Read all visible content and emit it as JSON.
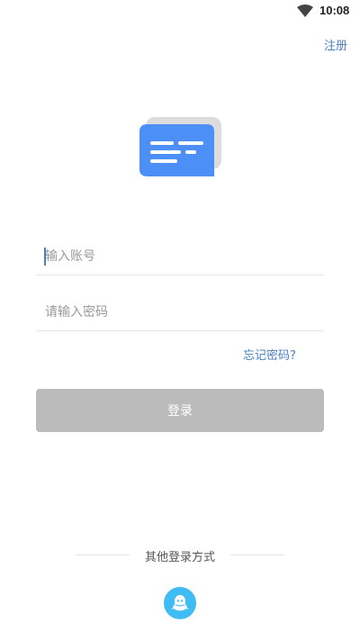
{
  "status_bar": {
    "time": "10:08",
    "wifi_icon": "wifi-icon"
  },
  "header": {
    "register_label": "注册"
  },
  "logo": {
    "icon": "chat-card-logo-icon",
    "front_color": "#4b8ff7",
    "back_color": "#dcdcdc"
  },
  "form": {
    "account_placeholder": "输入账号",
    "password_placeholder": "请输入密码",
    "forgot_label": "忘记密码?",
    "login_label": "登录",
    "login_color": "#bbbbbb",
    "link_color": "#4a7fc1"
  },
  "other_login": {
    "title": "其他登录方式",
    "qq_icon": "qq-icon",
    "qq_color": "#3fbcf4"
  }
}
